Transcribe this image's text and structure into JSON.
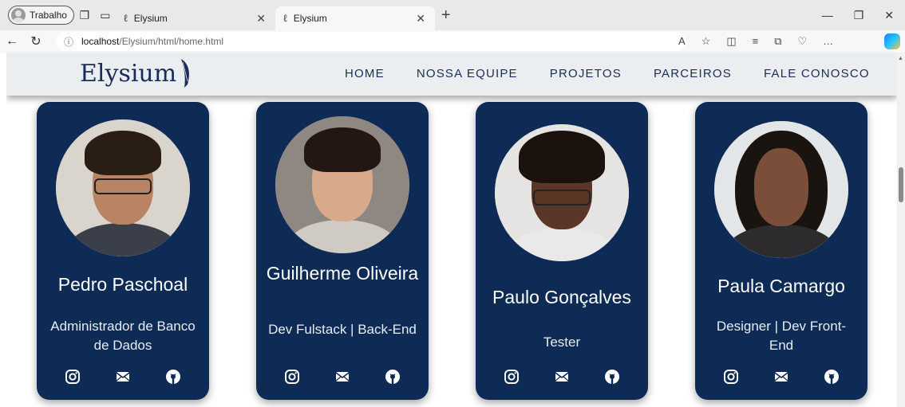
{
  "browser": {
    "profile_label": "Trabalho",
    "tabs": [
      {
        "title": "Elysium",
        "active": false
      },
      {
        "title": "Elysium",
        "active": true
      }
    ],
    "url_host": "localhost",
    "url_path": "/Elysium/html/home.html"
  },
  "site": {
    "logo": "Elysium",
    "nav": [
      "HOME",
      "NOSSA EQUIPE",
      "PROJETOS",
      "PARCEIROS",
      "FALE CONOSCO"
    ]
  },
  "team": [
    {
      "name": "Pedro Paschoal",
      "role": "Administrador de Banco de Dados"
    },
    {
      "name": "Guilherme Oliveira",
      "role": "Dev Fulstack | Back-End"
    },
    {
      "name": "Paulo Gonçalves",
      "role": "Tester"
    },
    {
      "name": "Paula Camargo",
      "role": "Designer | Dev Front-End"
    }
  ],
  "colors": {
    "card_bg": "#0d2b55",
    "header_bg": "#ebeef1",
    "brand_text": "#1c2b5a"
  },
  "icons": [
    "instagram-icon",
    "mail-icon",
    "github-icon"
  ]
}
